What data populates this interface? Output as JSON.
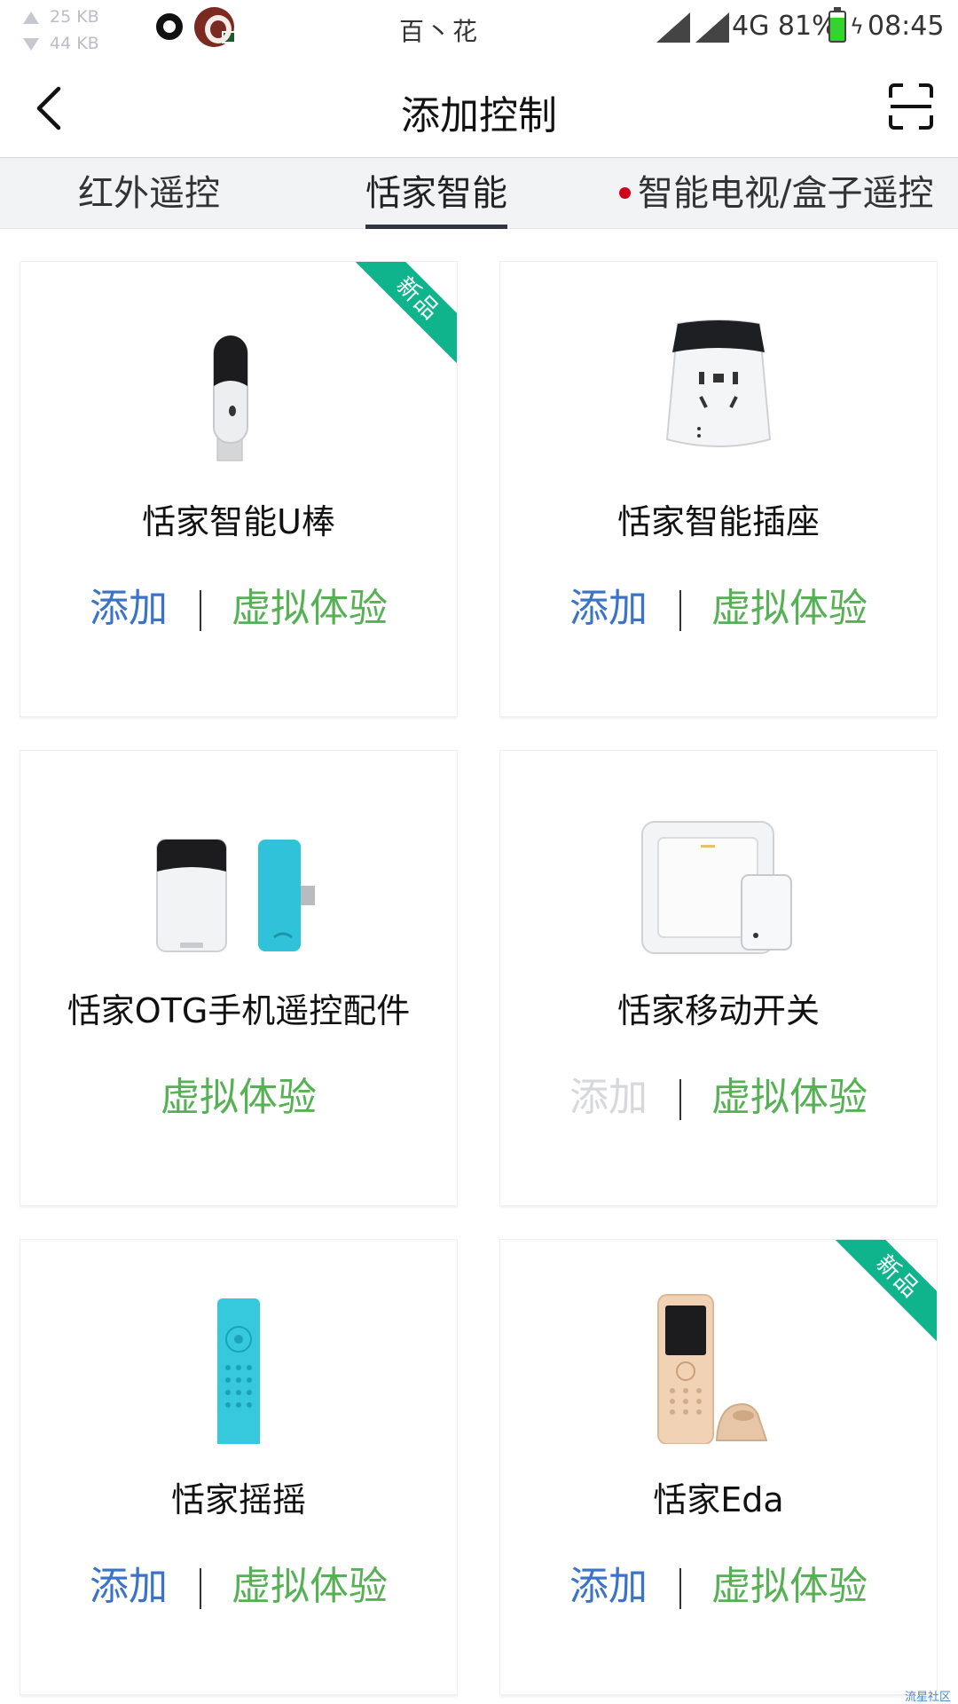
{
  "status_bar": {
    "upload": "25 KB",
    "download": "44 KB",
    "center_text": "百丶花",
    "network": "4G",
    "battery": "81%",
    "battery_level": 0.81,
    "time": "08:45"
  },
  "header": {
    "title": "添加控制"
  },
  "tabs": [
    {
      "label": "红外遥控"
    },
    {
      "label": "恬家智能",
      "active": true
    },
    {
      "label": "智能电视/盒子遥控",
      "has_dot": true
    }
  ],
  "products": [
    {
      "name": "恬家智能U棒",
      "badge": "新品",
      "add_label": "添加",
      "try_label": "虚拟体验"
    },
    {
      "name": "恬家智能插座",
      "add_label": "添加",
      "try_label": "虚拟体验"
    },
    {
      "name": "恬家OTG手机遥控配件",
      "try_label": "虚拟体验"
    },
    {
      "name": "恬家移动开关",
      "add_label": "添加",
      "add_disabled": true,
      "try_label": "虚拟体验"
    },
    {
      "name": "恬家摇摇",
      "add_label": "添加",
      "try_label": "虚拟体验"
    },
    {
      "name": "恬家Eda",
      "badge": "新品",
      "add_label": "添加",
      "try_label": "虚拟体验"
    }
  ],
  "watermark": "流星社区",
  "colors": {
    "add": "#3a73c8",
    "try": "#55b153",
    "badge": "#0fb48c",
    "tab_dot": "#d0021b"
  }
}
